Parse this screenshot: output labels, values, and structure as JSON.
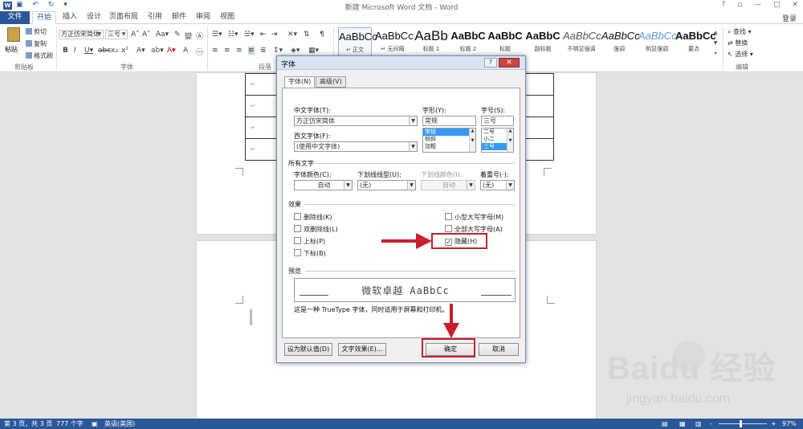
{
  "titlebar": {
    "app_icon_letter": "W",
    "title": "新建 Microsoft Word 文档 - Word",
    "help": "?",
    "restore": "▫",
    "minimize": "—",
    "maximize": "□",
    "close": "✕"
  },
  "tabs": {
    "file": "文件",
    "items": [
      "开始",
      "插入",
      "设计",
      "页面布局",
      "引用",
      "邮件",
      "审阅",
      "视图"
    ],
    "signin": "登录"
  },
  "ribbon": {
    "clipboard": {
      "paste": "粘贴",
      "cut": "剪切",
      "copy": "复制",
      "format_painter": "格式刷",
      "label": "剪贴板"
    },
    "font": {
      "font_name": "方正仿宋简体",
      "font_size": "三号",
      "label": "字体"
    },
    "paragraph_label": "段落",
    "styles": [
      {
        "sample": "AaBbCc",
        "name": "↵ 正文"
      },
      {
        "sample": "AaBbCc",
        "name": "↵ 无间隔"
      },
      {
        "sample": "AaBb",
        "name": "标题 1"
      },
      {
        "sample": "AaBbC",
        "name": "标题 2"
      },
      {
        "sample": "AaBbC",
        "name": "标题"
      },
      {
        "sample": "AaBbC",
        "name": "副标题"
      },
      {
        "sample": "AaBbCc",
        "name": "不明显强调"
      },
      {
        "sample": "AaBbCc",
        "name": "强调"
      },
      {
        "sample": "AaBbCc",
        "name": "明显强调"
      },
      {
        "sample": "AaBbCc",
        "name": "要点"
      }
    ],
    "editing": {
      "find": "查找",
      "replace": "替换",
      "select": "选择",
      "label": "编辑"
    }
  },
  "document": {
    "para_mark": "↵"
  },
  "statusbar": {
    "page": "第 3 页，共 3 页",
    "words": "777 个字",
    "language": "英语(美国)",
    "zoom": "97%",
    "zoom_minus": "-",
    "zoom_plus": "+"
  },
  "dialog": {
    "title": "字体",
    "help": "?",
    "close": "✕",
    "tab_font": "字体(N)",
    "tab_advanced": "高级(V)",
    "cn_font_label": "中文字体(T):",
    "cn_font_value": "方正仿宋简体",
    "west_font_label": "西文字体(F):",
    "west_font_value": "(使用中文字体)",
    "style_label": "字形(Y):",
    "style_value": "常规",
    "style_options": [
      "常规",
      "倾斜",
      "加粗"
    ],
    "size_label": "字号(S):",
    "size_value": "三号",
    "size_options": [
      "二号",
      "小二",
      "三号"
    ],
    "all_text_label": "所有文字",
    "font_color_label": "字体颜色(C):",
    "font_color_value": "自动",
    "underline_label": "下划线线型(U):",
    "underline_value": "(无)",
    "underline_color_label": "下划线颜色(I):",
    "underline_color_value": "自动",
    "emphasis_label": "着重号(·):",
    "emphasis_value": "(无)",
    "effects_label": "效果",
    "effects": {
      "strike": "删除线(K)",
      "double_strike": "双删除线(L)",
      "superscript": "上标(P)",
      "subscript": "下标(B)",
      "small_caps": "小型大写字母(M)",
      "all_caps": "全部大写字母(A)",
      "hidden": "隐藏(H)"
    },
    "preview_label": "预览",
    "preview_text": "微软卓越  AaBbCc",
    "preview_note": "这是一种 TrueType 字体，同时适用于屏幕和打印机。",
    "btn_default": "设为默认值(D)",
    "btn_text_effects": "文字效果(E)...",
    "btn_ok": "确定",
    "btn_cancel": "取消",
    "check_mark": "✓"
  },
  "watermark": {
    "brand": "Baidu 经验",
    "url": "jingyan.baidu.com"
  },
  "colors": {
    "accent": "#2b579a",
    "annotation_red": "#c8202a"
  }
}
